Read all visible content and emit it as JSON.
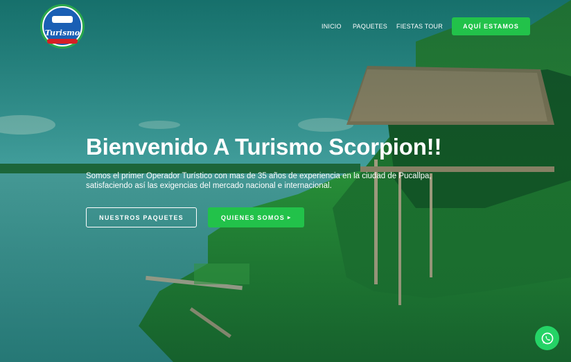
{
  "logo": {
    "word": "Turismo",
    "alt": "Turismo Scorpion logo"
  },
  "nav": {
    "items": [
      {
        "label": "INICIO"
      },
      {
        "label": "PAQUETES"
      },
      {
        "label": "FIESTAS TOUR"
      }
    ],
    "cta": "AQUÍ ESTAMOS"
  },
  "hero": {
    "title": "Bienvenido A Turismo Scorpion!!",
    "description": "Somos el primer Operador Turístico con mas de 35 años de experiencia en la ciudad de Pucallpa, satisfaciendo así las exigencias del mercado nacional e internacional.",
    "btn_packages": "NUESTROS PAQUETES",
    "btn_about": "QUIENES SOMOS"
  },
  "colors": {
    "accent": "#22c24a",
    "whatsapp": "#25d366"
  },
  "icons": {
    "whatsapp": "whatsapp-icon",
    "caret": "caret-right-icon"
  }
}
